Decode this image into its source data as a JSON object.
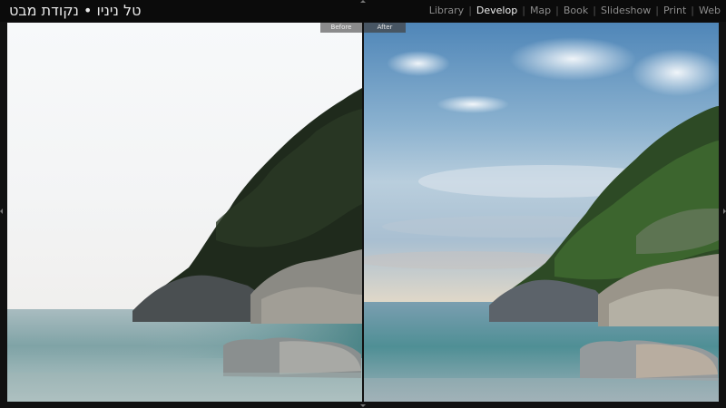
{
  "identity_plate": "טל ניניו • נקודת מבט",
  "modules": [
    {
      "label": "Library",
      "active": false
    },
    {
      "label": "Develop",
      "active": true
    },
    {
      "label": "Map",
      "active": false
    },
    {
      "label": "Book",
      "active": false
    },
    {
      "label": "Slideshow",
      "active": false
    },
    {
      "label": "Print",
      "active": false
    },
    {
      "label": "Web",
      "active": false
    }
  ],
  "compare": {
    "before_label": "Before",
    "after_label": "After"
  },
  "colors": {
    "active_module": "#f0f0f0",
    "inactive_module": "#8c8c8c",
    "background": "#111111"
  },
  "icons": [
    "panel-collapse-arrow-top",
    "panel-collapse-arrow-bottom",
    "panel-collapse-arrow-left",
    "panel-collapse-arrow-right"
  ]
}
